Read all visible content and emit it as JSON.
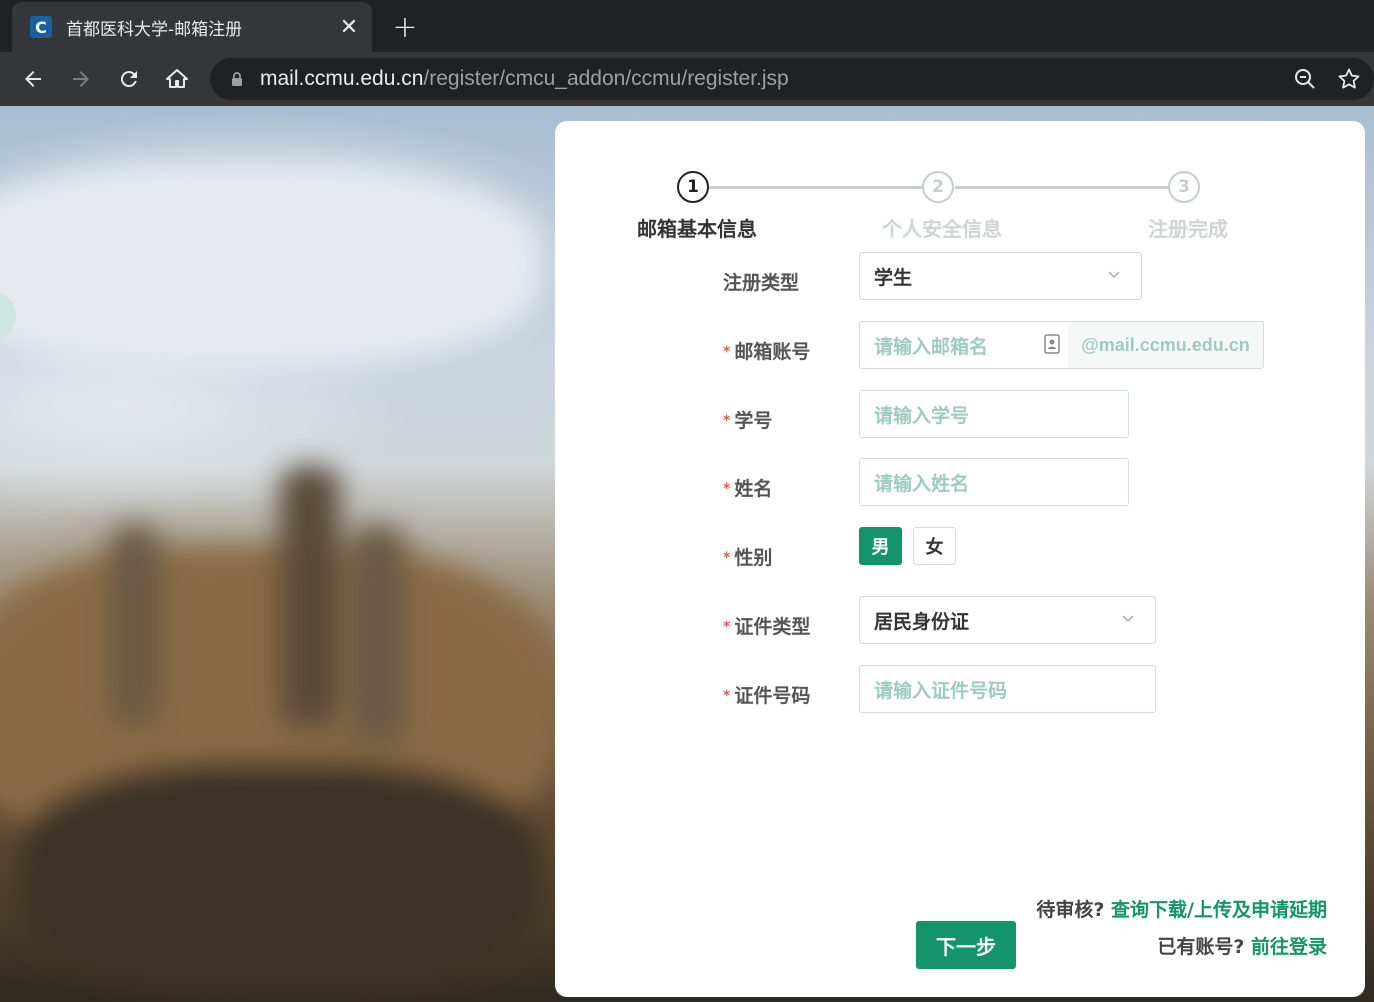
{
  "browser": {
    "tab_title": "首都医科大学-邮箱注册",
    "favicon_letter": "C",
    "url_host": "mail.ccmu.edu.cn",
    "url_path": "/register/cmcu_addon/ccmu/register.jsp"
  },
  "steps": [
    {
      "number": "1",
      "label": "邮箱基本信息",
      "active": true
    },
    {
      "number": "2",
      "label": "个人安全信息",
      "active": false
    },
    {
      "number": "3",
      "label": "注册完成",
      "active": false
    }
  ],
  "form": {
    "register_type": {
      "label": "注册类型",
      "value": "学生"
    },
    "email_account": {
      "label": "邮箱账号",
      "placeholder": "请输入邮箱名",
      "suffix": "@mail.ccmu.edu.cn"
    },
    "student_id": {
      "label": "学号",
      "placeholder": "请输入学号"
    },
    "name": {
      "label": "姓名",
      "placeholder": "请输入姓名"
    },
    "gender": {
      "label": "性别",
      "options": [
        "男",
        "女"
      ],
      "selected": "男"
    },
    "id_type": {
      "label": "证件类型",
      "value": "居民身份证"
    },
    "id_number": {
      "label": "证件号码",
      "placeholder": "请输入证件号码"
    },
    "required_mark": "*"
  },
  "actions": {
    "next_label": "下一步",
    "pending_question": "待审核?",
    "pending_link": "查询下载/上传及申请延期",
    "has_account_question": "已有账号?",
    "login_link": "前往登录"
  },
  "colors": {
    "accent": "#14946a",
    "placeholder": "#9ecbc0",
    "required": "#e05b5b"
  }
}
